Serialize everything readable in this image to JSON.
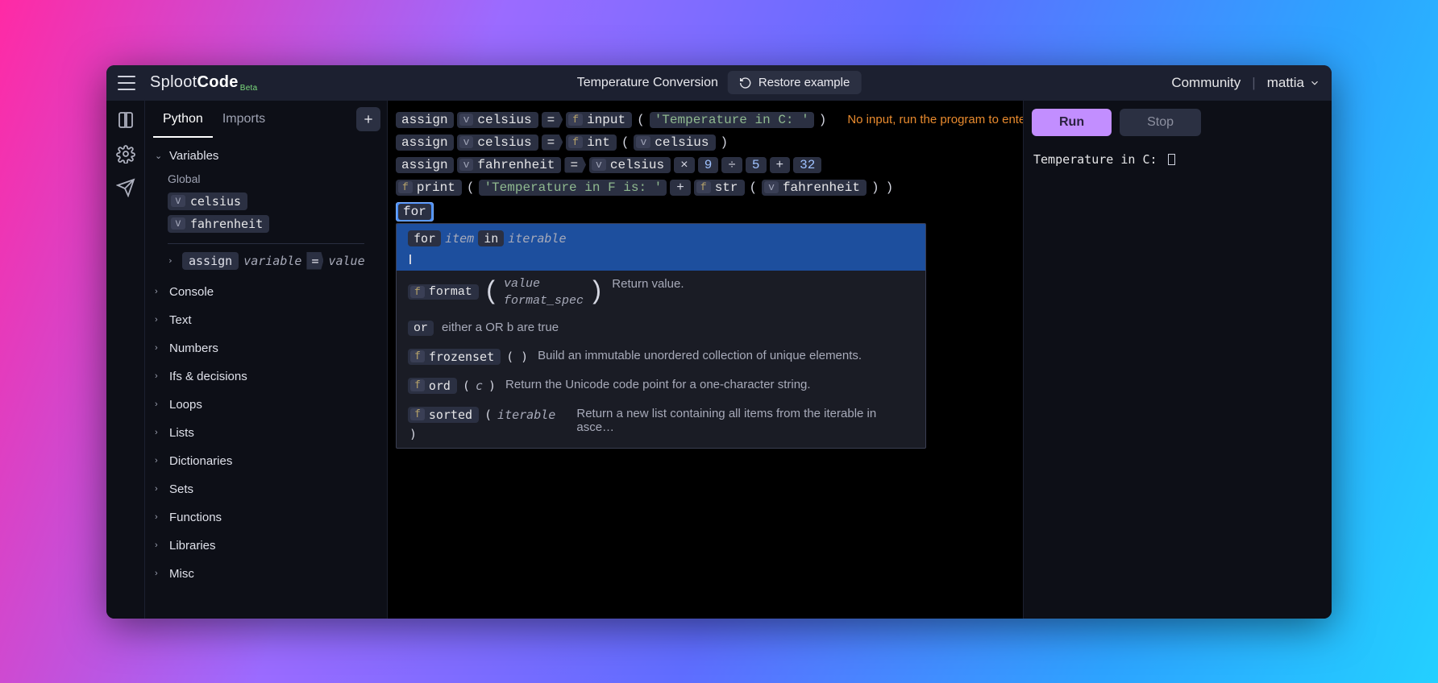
{
  "brand": {
    "part1": "Sploot",
    "part2": "Code",
    "tag": "Beta"
  },
  "header": {
    "project_name": "Temperature Conversion",
    "restore_label": "Restore example",
    "community": "Community",
    "user": "mattia"
  },
  "side_tabs": {
    "python": "Python",
    "imports": "Imports"
  },
  "variables": {
    "title": "Variables",
    "scope_label": "Global",
    "vars": [
      "celsius",
      "fahrenheit"
    ],
    "tmpl_kw": "assign",
    "tmpl_var": "variable",
    "tmpl_eq": "=",
    "tmpl_val": "value"
  },
  "sections": [
    "Console",
    "Text",
    "Numbers",
    "Ifs & decisions",
    "Loops",
    "Lists",
    "Dictionaries",
    "Sets",
    "Functions",
    "Libraries",
    "Misc"
  ],
  "code": {
    "l1": {
      "assign": "assign",
      "var": "celsius",
      "fn": "input",
      "arg": "'Temperature in C: '",
      "hint": "No input, run the program to enter inpu"
    },
    "l2": {
      "assign": "assign",
      "var": "celsius",
      "fn": "int",
      "arg_var": "celsius"
    },
    "l3": {
      "assign": "assign",
      "var": "fahrenheit",
      "src": "celsius",
      "n1": "9",
      "op1": "×",
      "n2": "5",
      "op2": "÷",
      "n3": "32",
      "op3": "+"
    },
    "l4": {
      "fn": "print",
      "str": "'Temperature in F is: '",
      "plus": "+",
      "fn2": "str",
      "arg_var": "fahrenheit"
    },
    "editing": "for"
  },
  "ac": {
    "r1": {
      "kw": "for",
      "item": "item",
      "in": "in",
      "iter": "iterable"
    },
    "r2": {
      "fn": "format",
      "a1": "value",
      "a2": "format_spec",
      "desc": "Return value."
    },
    "r3": {
      "kw": "or",
      "desc": "either a OR b are true"
    },
    "r4": {
      "fn": "frozenset",
      "desc": "Build an immutable unordered collection of unique elements."
    },
    "r5": {
      "fn": "ord",
      "arg": "c",
      "desc": "Return the Unicode code point for a one-character string."
    },
    "r6": {
      "fn": "sorted",
      "arg": "iterable",
      "desc": "Return a new list containing all items from the iterable in asce…"
    }
  },
  "run": {
    "run": "Run",
    "stop": "Stop"
  },
  "console_out": "Temperature in C: "
}
